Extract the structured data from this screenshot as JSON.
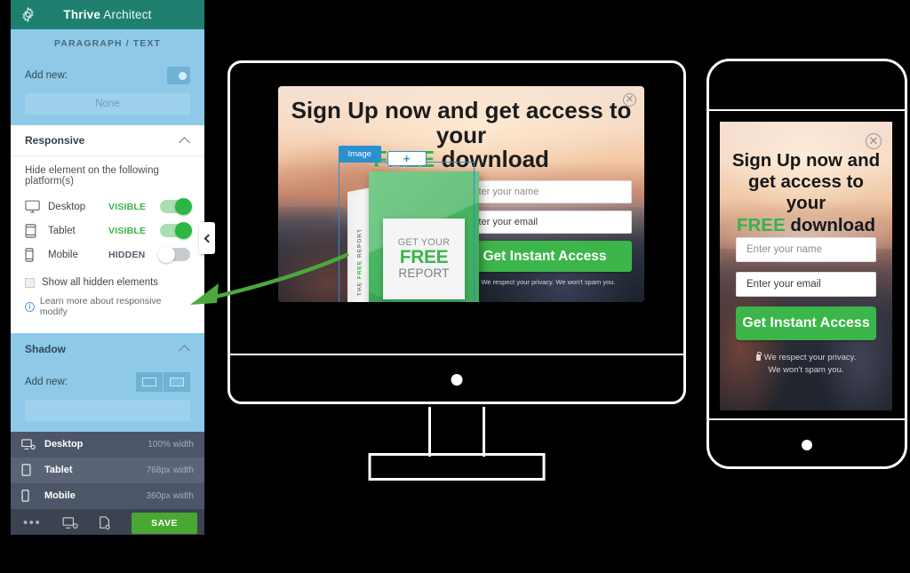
{
  "sidebar": {
    "app_title_bold": "Thrive",
    "app_title_light": " Architect",
    "gear_icon": "gear-icon",
    "element_type": "PARAGRAPH / TEXT",
    "animation": {
      "add_new_label": "Add new:",
      "value": "None"
    },
    "responsive": {
      "title": "Responsive",
      "hint": "Hide element on the following platform(s)",
      "platforms": [
        {
          "name": "Desktop",
          "state": "VISIBLE",
          "on": true,
          "icon": "desktop-icon"
        },
        {
          "name": "Tablet",
          "state": "VISIBLE",
          "on": true,
          "icon": "tablet-icon"
        },
        {
          "name": "Mobile",
          "state": "HIDDEN",
          "on": false,
          "icon": "mobile-icon"
        }
      ],
      "show_hidden_label": "Show all hidden elements",
      "learn_more": "Learn more about responsive modify"
    },
    "shadow": {
      "title": "Shadow",
      "add_new_label": "Add new:"
    },
    "devices": [
      {
        "name": "Desktop",
        "width": "100% width",
        "icon": "desktop-preview-icon"
      },
      {
        "name": "Tablet",
        "width": "768px width",
        "icon": "tablet-preview-icon"
      },
      {
        "name": "Mobile",
        "width": "360px width",
        "icon": "mobile-preview-icon"
      }
    ],
    "bottom_bar": {
      "more_label": "•••",
      "preview_icon": "device-preview-icon",
      "page_icon": "page-settings-icon",
      "save_label": "SAVE"
    },
    "collapse_icon": "chevron-left-icon"
  },
  "popup": {
    "headline_line1": "Sign Up now and get access to your",
    "headline_free": "FREE",
    "headline_rest": " download",
    "close_icon": "close-icon",
    "name_placeholder": "Enter your name",
    "email_value": "Enter your email",
    "cta_label": "Get Instant Access",
    "privacy": "We respect your privacy. We won't spam you.",
    "image_element": {
      "badge": "Image",
      "add_label": "+",
      "spine_pre": "THE ",
      "spine_free": "FREE",
      "spine_post": " REPORT",
      "label_line1": "GET YOUR",
      "label_line2": "FREE",
      "label_line3": "REPORT"
    }
  },
  "phone_popup": {
    "headline_l1": "Sign Up now and",
    "headline_l2": "get access to your",
    "headline_free": "FREE",
    "headline_rest": " download",
    "close_icon": "close-icon",
    "name_placeholder": "Enter your name",
    "email_value": "Enter your email",
    "cta_label": "Get Instant Access",
    "privacy_l1": "We respect your privacy.",
    "privacy_l2": "We won't spam you."
  },
  "colors": {
    "header_teal": "#1f8070",
    "sidebar_blue": "#8ecae8",
    "accent_green": "#3cb54a",
    "toggle_on": "#2cb742",
    "save_green": "#4aa832",
    "select_blue": "#2b8fd0",
    "dark_panel": "#4c5668"
  }
}
